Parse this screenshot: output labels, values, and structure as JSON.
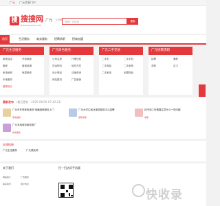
{
  "topbar": {
    "city": "广元",
    "nav_link": "广元信息门户"
  },
  "header": {
    "logo_mark": "搜",
    "logo_text": "搜搜网",
    "logo_url": "www.sousou.com",
    "city": "· 广元",
    "city_switch": "[切换]",
    "search_placeholder": "搜索广元信息",
    "search_button": "搜索"
  },
  "nav": {
    "items": [
      "首页",
      "生活服务",
      "商务服务",
      "招聘求职",
      "招商加盟"
    ]
  },
  "categories": [
    {
      "title": "广元生活服务",
      "items": [
        "家政保洁",
        "开锁换锁",
        "搬家",
        "管道疏通",
        "家电维修",
        "房屋维修",
        "本地服务",
        "装修设计"
      ]
    },
    {
      "title": "广元商务服务",
      "items": [
        "公司注册",
        "代理记账",
        "货运物流",
        "软件开发",
        "设计策划",
        "法律咨询",
        "网站建设",
        "广告营销"
      ]
    },
    {
      "title": "广元二手交易",
      "items": [
        "二手车",
        "二手手机",
        "二手电脑",
        "二手家具",
        "二手家电",
        "闲置物品"
      ]
    },
    {
      "title": "广元招聘求职",
      "items": [
        "招聘",
        "兼职",
        "求职",
        "实习"
      ]
    }
  ],
  "news": {
    "title": "最新发布",
    "updated": "（最近更新：2025-08-06 07:42:21）",
    "items": [
      {
        "title": "广元市冬季家电清洗·电器维修服务上门",
        "meta": "家电维修"
      },
      {
        "title": "广元大学生就业指导服务中心招聘",
        "meta": "招聘求职"
      },
      {
        "title": "找不到工作需要注意什么一些问题",
        "meta": "求职"
      },
      {
        "title": "广元本地商务服务推广",
        "meta": "商务服务"
      }
    ]
  },
  "friends": {
    "title": "友情链接",
    "links": [
      "广元生活服务",
      "广元便民网"
    ]
  },
  "footer": {
    "about_title": "关于我们",
    "about_links": [
      "网站简介",
      "广告服务",
      "联系我们",
      "用户协议"
    ],
    "follow_title": "扫一扫访问手机版",
    "watermark": "快收录"
  },
  "colors": {
    "accent": "#e4393c"
  }
}
